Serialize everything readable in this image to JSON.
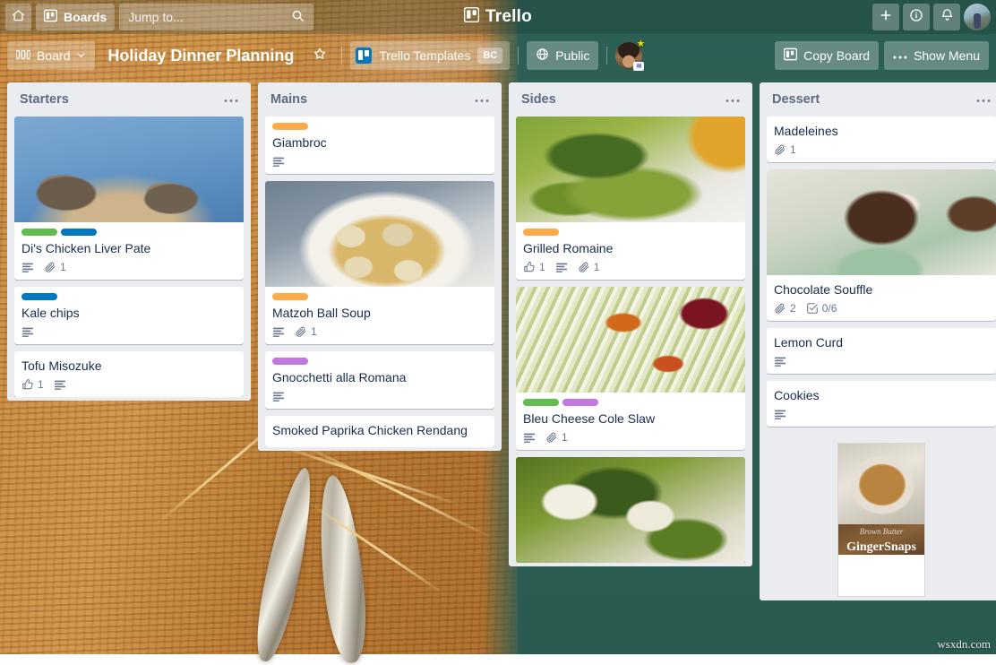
{
  "topnav": {
    "home_icon": "home-icon",
    "boards_label": "Boards",
    "boards_icon": "board-icon",
    "jump_to_placeholder": "Jump to...",
    "search_icon": "search-icon",
    "logo_text": "Trello",
    "logo_icon": "trello-logo-icon",
    "add_icon": "plus-icon",
    "info_icon": "info-icon",
    "notifications_icon": "bell-icon",
    "avatar": "user-avatar"
  },
  "boardbar": {
    "view_label": "Board",
    "view_icon": "board-view-icon",
    "chevron_icon": "chevron-down-icon",
    "title": "Holiday Dinner Planning",
    "star_icon": "star-icon",
    "team_name": "Trello Templates",
    "team_plan_badge": "BC",
    "visibility_label": "Public",
    "visibility_icon": "globe-icon",
    "copy_board_label": "Copy Board",
    "copy_board_icon": "board-icon",
    "show_menu_label": "Show Menu",
    "show_menu_icon": "ellipsis-icon"
  },
  "labels": {
    "green": "#61bd4f",
    "blue": "#0079bf",
    "orange": "#ffab4a",
    "purple": "#c377e0"
  },
  "lists": [
    {
      "title": "Starters",
      "menu_icon": "list-menu-icon",
      "cards": [
        {
          "title": "Di's Chicken Liver Pate",
          "cover": "cover-pate",
          "labels": [
            "green",
            "blue"
          ],
          "badges": [
            {
              "icon": "description-icon",
              "value": ""
            },
            {
              "icon": "attachment-icon",
              "value": "1"
            }
          ]
        },
        {
          "title": "Kale chips",
          "cover": "",
          "labels": [
            "blue"
          ],
          "badges": [
            {
              "icon": "description-icon",
              "value": ""
            }
          ]
        },
        {
          "title": "Tofu Misozuke",
          "cover": "",
          "labels": [],
          "badges": [
            {
              "icon": "vote-icon",
              "value": "1"
            },
            {
              "icon": "description-icon",
              "value": ""
            }
          ]
        }
      ]
    },
    {
      "title": "Mains",
      "menu_icon": "list-menu-icon",
      "cards": [
        {
          "title": "Giambroc",
          "cover": "",
          "labels": [
            "orange"
          ],
          "badges": [
            {
              "icon": "description-icon",
              "value": ""
            }
          ]
        },
        {
          "title": "Matzoh Ball Soup",
          "cover": "cover-soup",
          "labels": [
            "orange"
          ],
          "badges": [
            {
              "icon": "description-icon",
              "value": ""
            },
            {
              "icon": "attachment-icon",
              "value": "1"
            }
          ]
        },
        {
          "title": "Gnocchetti alla Romana",
          "cover": "",
          "labels": [
            "purple"
          ],
          "badges": [
            {
              "icon": "description-icon",
              "value": ""
            }
          ]
        },
        {
          "title": "Smoked Paprika Chicken Rendang",
          "cover": "",
          "labels": [],
          "badges": []
        }
      ]
    },
    {
      "title": "Sides",
      "menu_icon": "list-menu-icon",
      "cards": [
        {
          "title": "Grilled Romaine",
          "cover": "cover-romaine",
          "labels": [
            "orange"
          ],
          "badges": [
            {
              "icon": "vote-icon",
              "value": "1"
            },
            {
              "icon": "description-icon",
              "value": ""
            },
            {
              "icon": "attachment-icon",
              "value": "1"
            }
          ]
        },
        {
          "title": "Bleu Cheese Cole Slaw",
          "cover": "cover-slaw",
          "labels": [
            "green",
            "purple"
          ],
          "badges": [
            {
              "icon": "description-icon",
              "value": ""
            },
            {
              "icon": "attachment-icon",
              "value": "1"
            }
          ]
        },
        {
          "title": "",
          "cover": "cover-greens",
          "labels": [],
          "badges": []
        }
      ]
    },
    {
      "title": "Dessert",
      "menu_icon": "list-menu-icon",
      "cards": [
        {
          "title": "Madeleines",
          "cover": "",
          "labels": [],
          "badges": [
            {
              "icon": "attachment-icon",
              "value": "1"
            }
          ]
        },
        {
          "title": "Chocolate Souffle",
          "cover": "cover-souffle",
          "labels": [],
          "badges": [
            {
              "icon": "attachment-icon",
              "value": "2"
            },
            {
              "icon": "checklist-icon",
              "value": "0/6"
            }
          ]
        },
        {
          "title": "Lemon Curd",
          "cover": "",
          "labels": [],
          "badges": [
            {
              "icon": "description-icon",
              "value": ""
            }
          ]
        },
        {
          "title": "Cookies",
          "cover": "",
          "labels": [],
          "badges": [
            {
              "icon": "description-icon",
              "value": ""
            }
          ]
        }
      ]
    }
  ],
  "cookie_image": {
    "script_text": "Brown Butter",
    "title_text": "GingerSnaps"
  },
  "watermark": "wsxdn.com"
}
